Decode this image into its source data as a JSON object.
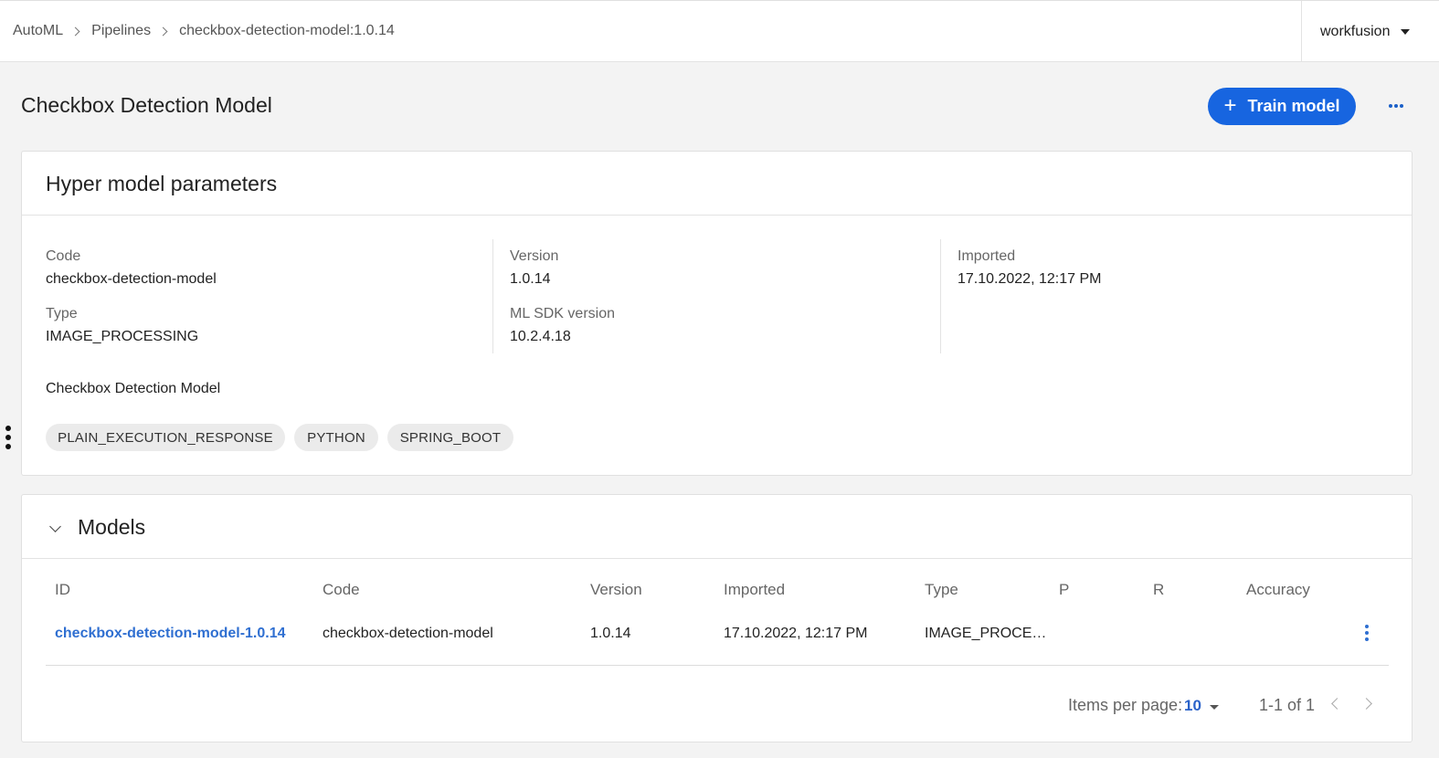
{
  "breadcrumb": [
    "AutoML",
    "Pipelines",
    "checkbox-detection-model:1.0.14"
  ],
  "tenant": {
    "name": "workfusion"
  },
  "page": {
    "title": "Checkbox Detection Model",
    "train_button": "Train model",
    "train_icon": "+"
  },
  "params": {
    "title": "Hyper model parameters",
    "code_label": "Code",
    "code_value": "checkbox-detection-model",
    "type_label": "Type",
    "type_value": "IMAGE_PROCESSING",
    "version_label": "Version",
    "version_value": "1.0.14",
    "sdk_label": "ML SDK version",
    "sdk_value": "10.2.4.18",
    "imported_label": "Imported",
    "imported_value": "17.10.2022, 12:17 PM",
    "description": "Checkbox Detection Model",
    "tags": [
      "PLAIN_EXECUTION_RESPONSE",
      "PYTHON",
      "SPRING_BOOT"
    ]
  },
  "models": {
    "title": "Models",
    "columns": [
      "ID",
      "Code",
      "Version",
      "Imported",
      "Type",
      "P",
      "R",
      "Accuracy"
    ],
    "rows": [
      {
        "id": "checkbox-detection-model-1.0.14",
        "code": "checkbox-detection-model",
        "version": "1.0.14",
        "imported": "17.10.2022, 12:17 PM",
        "type": "IMAGE_PROCE…",
        "p": "",
        "r": "",
        "accuracy": ""
      }
    ],
    "pagination": {
      "items_per_page_label": "Items per page:",
      "items_per_page": "10",
      "range": "1-1 of 1"
    }
  },
  "colors": {
    "primary": "#1765e0",
    "link": "#2f6fd1",
    "background": "#f3f3f3"
  }
}
